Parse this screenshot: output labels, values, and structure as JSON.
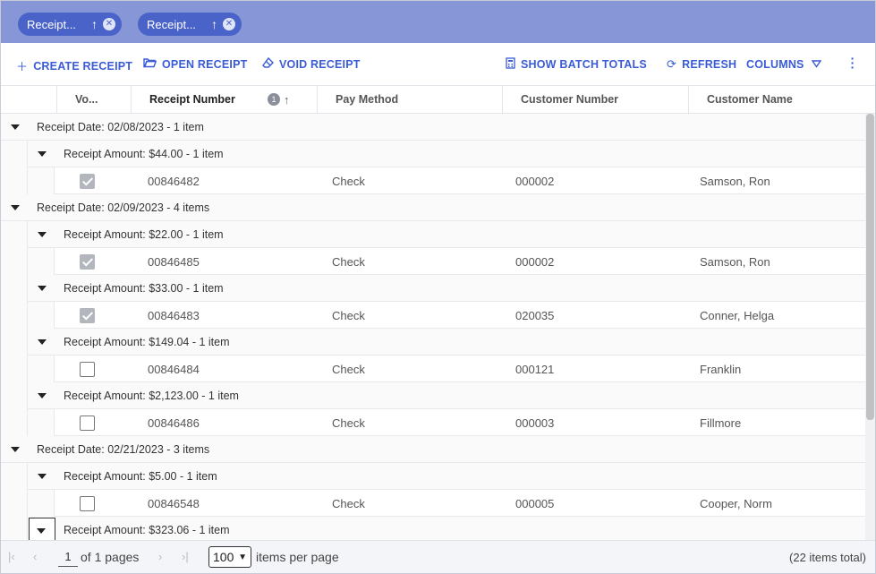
{
  "group_chips": [
    {
      "label": "Receipt...",
      "sort": "↑"
    },
    {
      "label": "Receipt...",
      "sort": "↑"
    }
  ],
  "toolbar": {
    "create_receipt": "CREATE RECEIPT",
    "open_receipt": "OPEN RECEIPT",
    "void_receipt": "VOID RECEIPT",
    "show_batch_totals": "SHOW BATCH TOTALS",
    "refresh": "REFRESH",
    "columns": "COLUMNS"
  },
  "columns": {
    "void": "Vo...",
    "receipt_number": "Receipt Number",
    "sort_badge": "1",
    "sort_arrow": "↑",
    "pay_method": "Pay Method",
    "customer_number": "Customer Number",
    "customer_name": "Customer Name"
  },
  "rows": [
    {
      "type": "date",
      "label": "Receipt Date: 02/08/2023 - 1 item"
    },
    {
      "type": "amount",
      "label": "Receipt Amount: $44.00 - 1 item"
    },
    {
      "type": "data",
      "voided": true,
      "receipt_number": "00846482",
      "pay_method": "Check",
      "customer_number": "000002",
      "customer_name": "Samson, Ron"
    },
    {
      "type": "date",
      "label": "Receipt Date: 02/09/2023 - 4 items"
    },
    {
      "type": "amount",
      "label": "Receipt Amount: $22.00 - 1 item"
    },
    {
      "type": "data",
      "voided": true,
      "receipt_number": "00846485",
      "pay_method": "Check",
      "customer_number": "000002",
      "customer_name": "Samson, Ron"
    },
    {
      "type": "amount",
      "label": "Receipt Amount: $33.00 - 1 item"
    },
    {
      "type": "data",
      "voided": true,
      "receipt_number": "00846483",
      "pay_method": "Check",
      "customer_number": "020035",
      "customer_name": "Conner, Helga"
    },
    {
      "type": "amount",
      "label": "Receipt Amount: $149.04 - 1 item"
    },
    {
      "type": "data",
      "voided": false,
      "receipt_number": "00846484",
      "pay_method": "Check",
      "customer_number": "000121",
      "customer_name": "Franklin"
    },
    {
      "type": "amount",
      "label": "Receipt Amount: $2,123.00 - 1 item"
    },
    {
      "type": "data",
      "voided": false,
      "receipt_number": "00846486",
      "pay_method": "Check",
      "customer_number": "000003",
      "customer_name": "Fillmore"
    },
    {
      "type": "date",
      "label": "Receipt Date: 02/21/2023 - 3 items"
    },
    {
      "type": "amount",
      "label": "Receipt Amount: $5.00 - 1 item"
    },
    {
      "type": "data",
      "voided": false,
      "receipt_number": "00846548",
      "pay_method": "Check",
      "customer_number": "000005",
      "customer_name": "Cooper, Norm"
    },
    {
      "type": "amount",
      "label": "Receipt Amount: $323.06 - 1 item"
    }
  ],
  "pager": {
    "current_page": "1",
    "of_pages": "of 1 pages",
    "per_page": "100",
    "items_per_page": "items per page",
    "total": "(22 items total)"
  }
}
